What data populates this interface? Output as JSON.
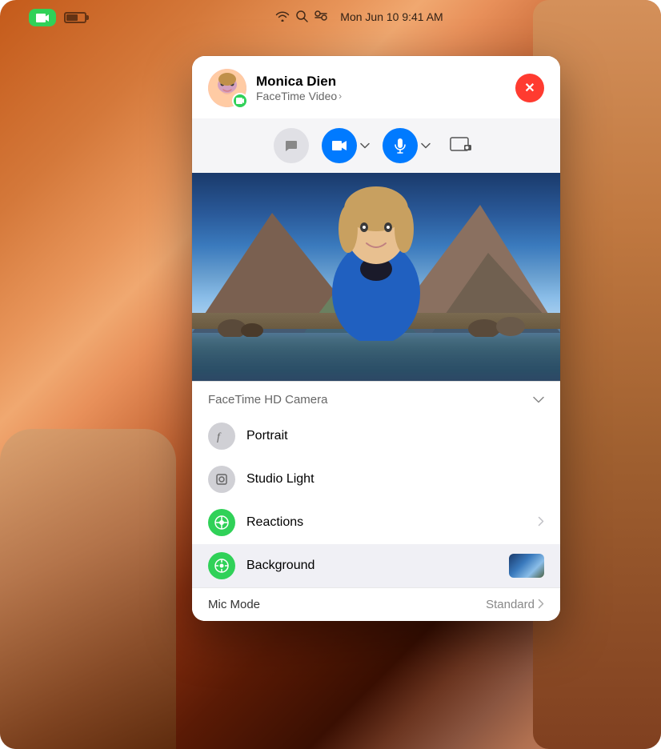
{
  "desktop": {
    "bg_description": "macOS desktop warm gradient background"
  },
  "menubar": {
    "app_icon": "📹",
    "date_time": "Mon Jun 10  9:41 AM",
    "icons": [
      "wifi",
      "search",
      "control-center"
    ]
  },
  "facetime_window": {
    "caller_name": "Monica Dien",
    "call_type": "FaceTime Video",
    "call_type_chevron": "›",
    "close_button_label": "✕",
    "controls": {
      "message_label": "💬",
      "video_label": "📹",
      "mic_label": "🎤",
      "share_label": "⬛"
    },
    "camera_section": {
      "label": "FaceTime HD Camera",
      "chevron": "⌄"
    },
    "menu_items": [
      {
        "id": "portrait",
        "icon_char": "f",
        "icon_style": "gray",
        "label": "Portrait",
        "has_chevron": false
      },
      {
        "id": "studio-light",
        "icon_char": "◎",
        "icon_style": "gray",
        "label": "Studio Light",
        "has_chevron": false
      },
      {
        "id": "reactions",
        "icon_char": "⊕",
        "icon_style": "green",
        "label": "Reactions",
        "has_chevron": true
      },
      {
        "id": "background",
        "icon_char": "⊕",
        "icon_style": "green",
        "label": "Background",
        "has_chevron": false,
        "is_selected": true,
        "has_thumbnail": true
      }
    ],
    "mic_mode": {
      "label": "Mic Mode",
      "value": "Standard",
      "chevron": "›"
    }
  }
}
